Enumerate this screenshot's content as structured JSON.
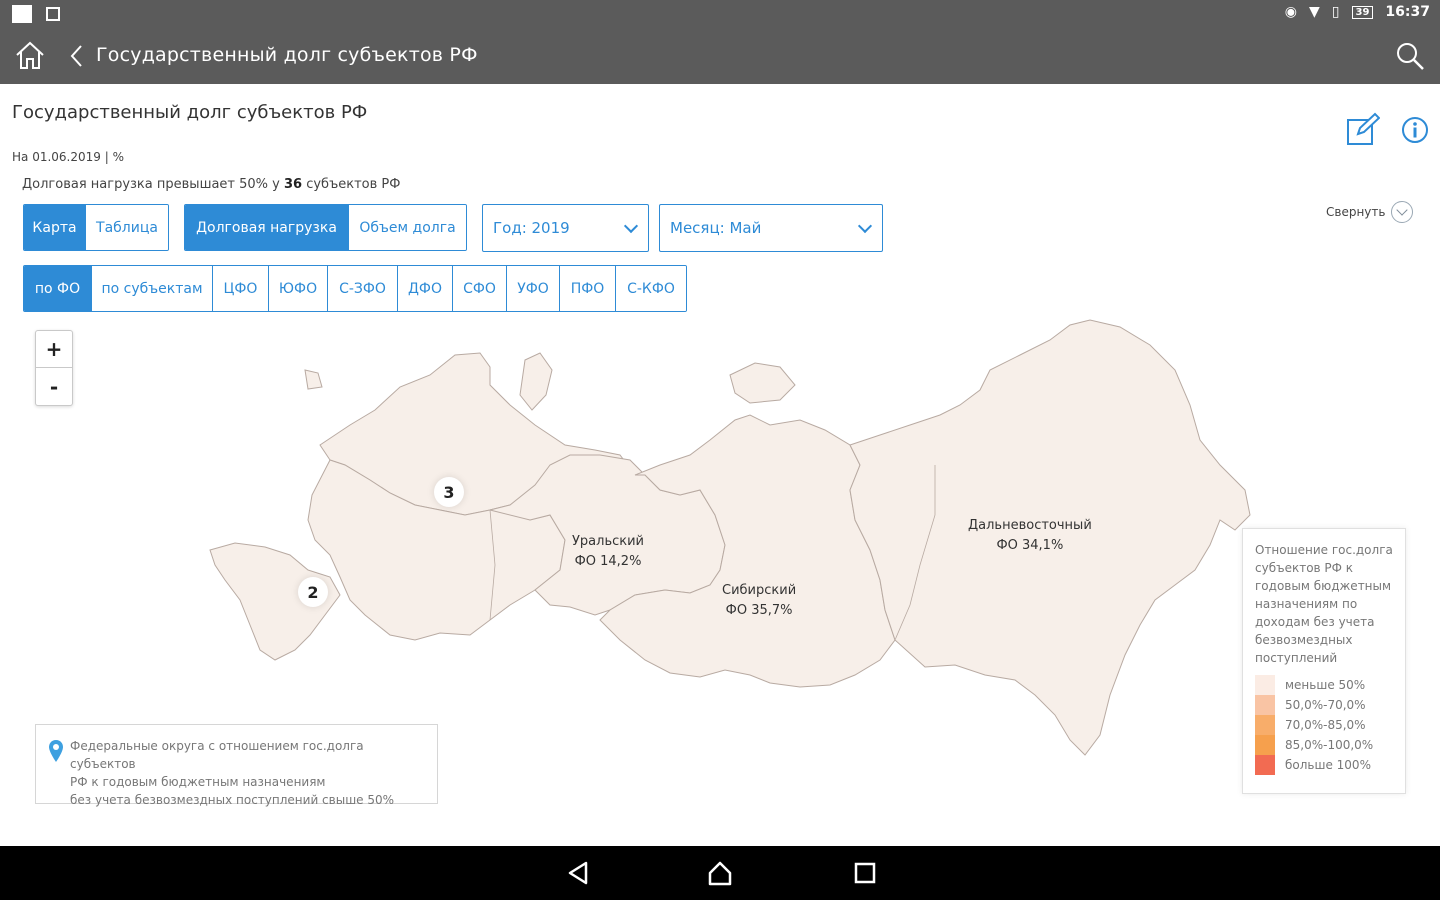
{
  "statusbar": {
    "time": "16:37",
    "battery": "39"
  },
  "appbar": {
    "title": "Государственный долг субъектов РФ"
  },
  "page": {
    "title": "Государственный долг субъектов РФ",
    "date_line": "На 01.06.2019 | %",
    "summary_prefix": "Долговая нагрузка превышает 50% у ",
    "summary_count": "36",
    "summary_suffix": " субъектов РФ",
    "collapse_label": "Свернуть"
  },
  "view_toggle": {
    "map": "Карта",
    "table": "Таблица"
  },
  "metric_toggle": {
    "load": "Долговая нагрузка",
    "volume": "Объем долга"
  },
  "year_select": {
    "value": "Год: 2019"
  },
  "month_select": {
    "value": "Месяц: Май"
  },
  "district_tabs": [
    "по ФО",
    "по субъектам",
    "ЦФО",
    "ЮФО",
    "С-ЗФО",
    "ДФО",
    "СФО",
    "УФО",
    "ПФО",
    "С-КФО"
  ],
  "zoom": {
    "in": "+",
    "out": "-"
  },
  "map": {
    "labels": {
      "ural": {
        "name": "Уральский",
        "value": "ФО 14,2%"
      },
      "siberia": {
        "name": "Сибирский",
        "value": "ФО 35,7%"
      },
      "fareast": {
        "name": "Дальневосточный",
        "value": "ФО 34,1%"
      }
    },
    "clusters": {
      "north_west": "3",
      "south": "2"
    },
    "fill_color": "#f7efe9",
    "border_color": "#b8aaa2"
  },
  "note": {
    "line1": "Федеральные округа с отношением гос.долга субъектов",
    "line2": "РФ к годовым бюджетным назначениям",
    "line3": "без учета безвозмездных поступлений свыше 50%"
  },
  "legend": {
    "title": "Отношение гос.долга субъектов РФ к годовым бюджетным назначениям по доходам без учета безвозмездных поступлений",
    "items": [
      {
        "label": "меньше 50%",
        "color": "#fbece4"
      },
      {
        "label": "50,0%-70,0%",
        "color": "#f9c4a4"
      },
      {
        "label": "70,0%-85,0%",
        "color": "#f8ad6a"
      },
      {
        "label": "85,0%-100,0%",
        "color": "#f6a04d"
      },
      {
        "label": "больше 100%",
        "color": "#f26b52"
      }
    ]
  },
  "colors": {
    "accent": "#2e8bd6",
    "appbar": "#5b5b5b"
  }
}
